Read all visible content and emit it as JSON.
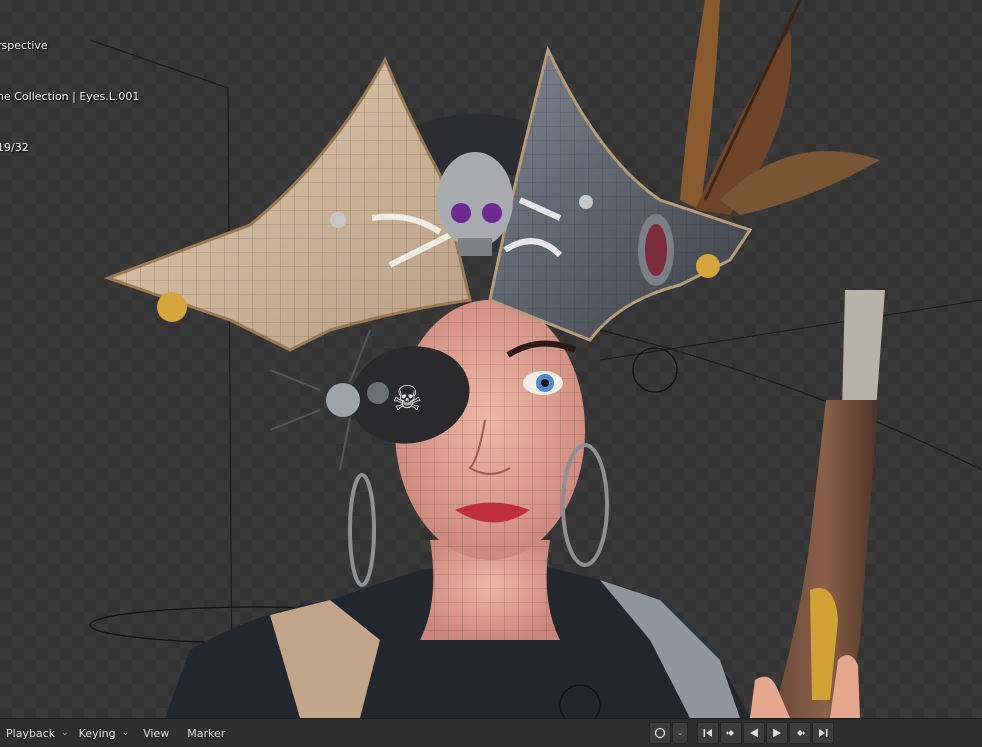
{
  "viewport": {
    "overlay_lines": [
      "rspective",
      "ne Collection | Eyes.L.001",
      "19/32"
    ]
  },
  "timeline": {
    "playback_label": "Playback",
    "keying_label": "Keying",
    "view_label": "View",
    "marker_label": "Marker"
  },
  "icons": {
    "autokey": "record-circle-icon",
    "jump_start": "jump-to-start-icon",
    "prev_key": "previous-keyframe-icon",
    "play_reverse": "play-reverse-icon",
    "play": "play-icon",
    "next_key": "next-keyframe-icon",
    "jump_end": "jump-to-end-icon"
  },
  "colors": {
    "viewport_bg": "#3a3a3a",
    "header_bg": "#2e2e2e",
    "accent": "#4d7fc4"
  }
}
